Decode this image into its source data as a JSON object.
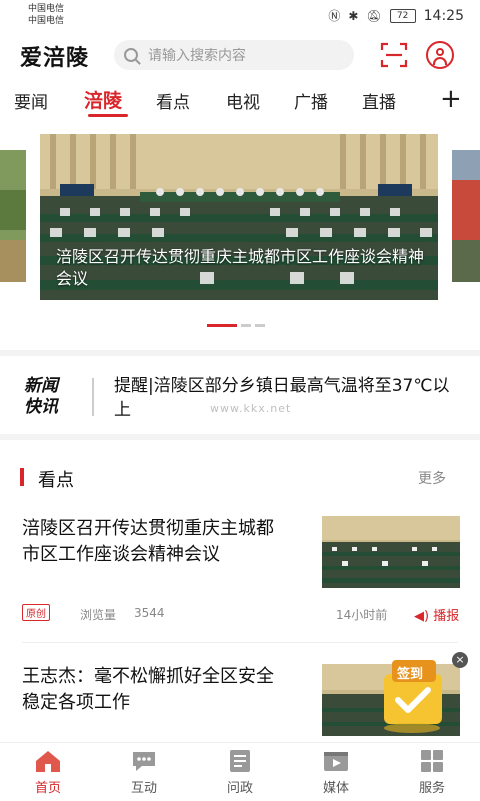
{
  "status_bar": {
    "carrier1": "中国电信",
    "carrier2": "中国电信",
    "battery": "72",
    "time": "14:25"
  },
  "header": {
    "logo": "爱涪陵",
    "search_placeholder": "请输入搜索内容"
  },
  "tabs": [
    {
      "label": "要闻"
    },
    {
      "label": "涪陵"
    },
    {
      "label": "看点"
    },
    {
      "label": "电视"
    },
    {
      "label": "广播"
    },
    {
      "label": "直播"
    }
  ],
  "tab_plus": "+",
  "banner": {
    "caption": "涪陵区召开传达贯彻重庆主城都市区工作座谈会精神会议"
  },
  "flash": {
    "label_line1": "新闻",
    "label_line2": "快讯",
    "text": "提醒|涪陵区部分乡镇日最高气温将至37℃以上",
    "watermark": "www.kkx.net"
  },
  "section": {
    "title": "看点",
    "more": "更多"
  },
  "news": [
    {
      "title": "涪陵区召开传达贯彻重庆主城都市区工作座谈会精神会议",
      "tag": "原创",
      "views_label": "浏览量",
      "views": "3544",
      "time": "14小时前",
      "play": "播报"
    },
    {
      "title": "王志杰：毫不松懈抓好全区安全稳定各项工作"
    }
  ],
  "checkin": {
    "label": "签到",
    "close": "×"
  },
  "bottom_nav": [
    {
      "label": "首页"
    },
    {
      "label": "互动"
    },
    {
      "label": "问政"
    },
    {
      "label": "媒体"
    },
    {
      "label": "服务"
    }
  ],
  "colors": {
    "accent": "#d8262b"
  }
}
